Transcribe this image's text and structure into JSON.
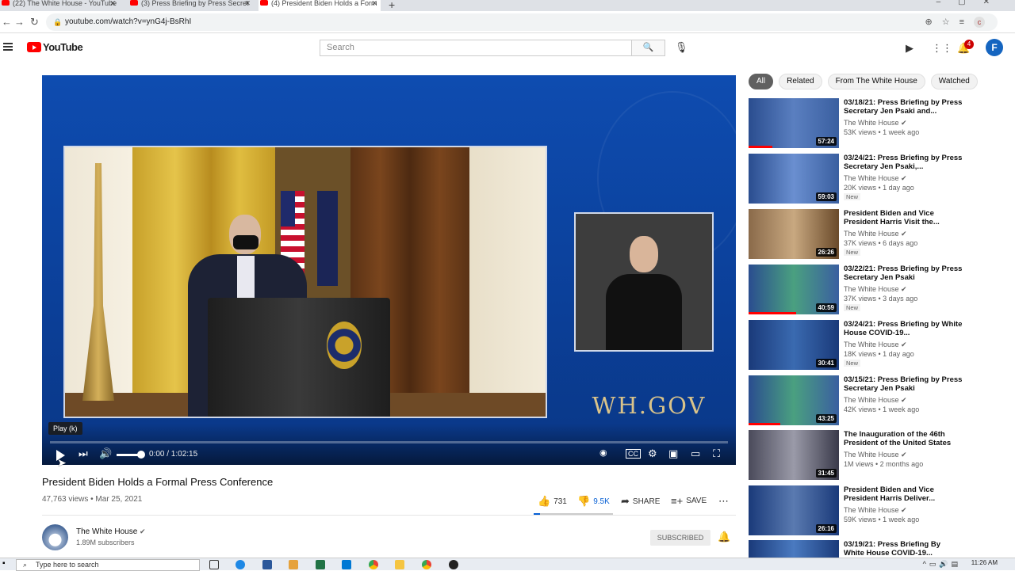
{
  "browser": {
    "tabs": [
      {
        "label": "(22) The White House - YouTube"
      },
      {
        "label": "(3) Press Briefing by Press Secret"
      },
      {
        "label": "(4) President Biden Holds a Form"
      }
    ],
    "url": "youtube.com/watch?v=ynG4j-BsRhI",
    "profile_initial": "c"
  },
  "youtube": {
    "logo_text": "YouTube",
    "search_placeholder": "Search",
    "notification_count": "4",
    "user_initial": "F"
  },
  "player": {
    "overlay_text": "WH.GOV",
    "tooltip": "Play (k)",
    "time": "0:00 / 1:02:15"
  },
  "video": {
    "title": "President Biden Holds a Formal Press Conference",
    "meta": "47,763 views • Mar 25, 2021",
    "likes": "731",
    "dislikes": "9.5K",
    "share_label": "SHARE",
    "save_label": "SAVE",
    "channel_name": "The White House",
    "channel_subs": "1.89M subscribers",
    "subscribed_label": "SUBSCRIBED"
  },
  "chips": [
    "All",
    "Related",
    "From The White House",
    "Watched"
  ],
  "recommendations": [
    {
      "title": "03/18/21: Press Briefing by Press Secretary Jen Psaki and...",
      "channel": "The White House",
      "views": "53K views • 1 week ago",
      "duration": "57:24",
      "new": ""
    },
    {
      "title": "03/24/21: Press Briefing by Press Secretary Jen Psaki,...",
      "channel": "The White House",
      "views": "20K views • 1 day ago",
      "duration": "59:03",
      "new": "New"
    },
    {
      "title": "President Biden and Vice President Harris Visit the...",
      "channel": "The White House",
      "views": "37K views • 6 days ago",
      "duration": "26:26",
      "new": "New"
    },
    {
      "title": "03/22/21: Press Briefing by Press Secretary Jen Psaki",
      "channel": "The White House",
      "views": "37K views • 3 days ago",
      "duration": "40:59",
      "new": "New"
    },
    {
      "title": "03/24/21: Press Briefing by White House COVID-19...",
      "channel": "The White House",
      "views": "18K views • 1 day ago",
      "duration": "30:41",
      "new": "New"
    },
    {
      "title": "03/15/21: Press Briefing by Press Secretary Jen Psaki",
      "channel": "The White House",
      "views": "42K views • 1 week ago",
      "duration": "43:25",
      "new": ""
    },
    {
      "title": "The Inauguration of the 46th President of the United States",
      "channel": "The White House",
      "views": "1M views • 2 months ago",
      "duration": "31:45",
      "new": ""
    },
    {
      "title": "President Biden and Vice President Harris Deliver...",
      "channel": "The White House",
      "views": "59K views • 1 week ago",
      "duration": "26:16",
      "new": ""
    },
    {
      "title": "03/19/21: Press Briefing By White House COVID-19...",
      "channel": "",
      "views": "",
      "duration": "",
      "new": ""
    }
  ],
  "taskbar": {
    "search_placeholder": "Type here to search",
    "clock": "11:26 AM"
  }
}
